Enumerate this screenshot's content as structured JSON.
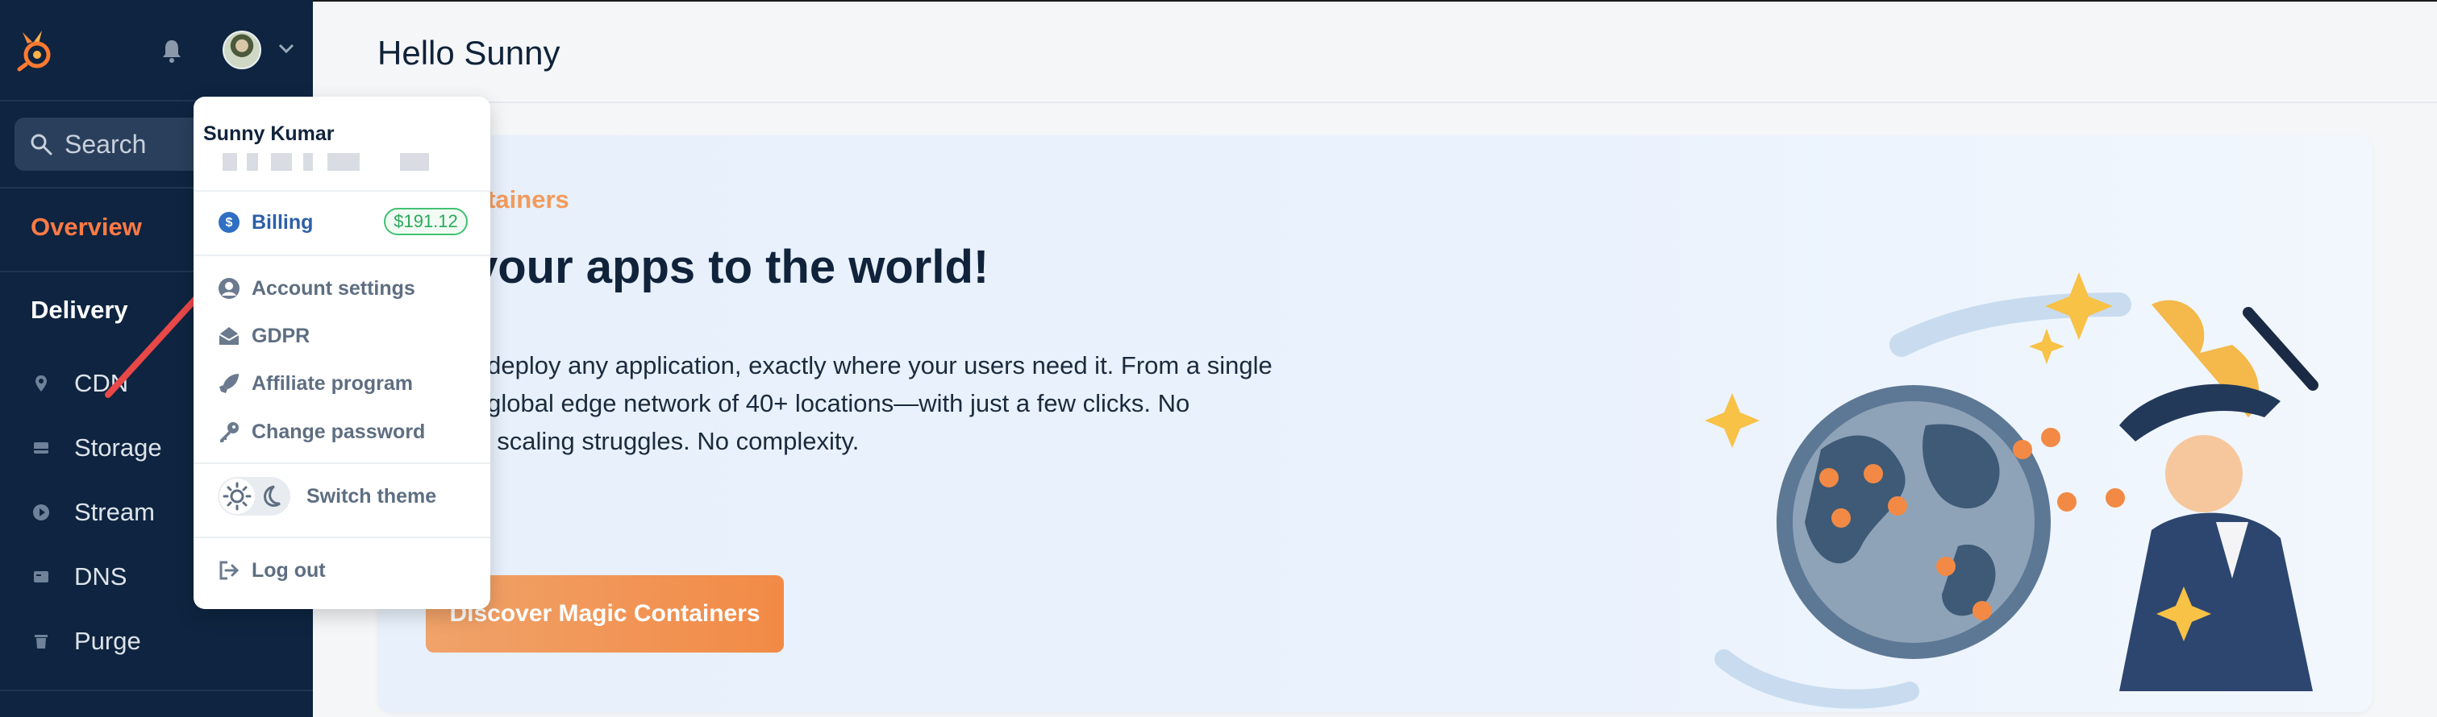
{
  "colors": {
    "sidebar_bg": "#0e2440",
    "accent_orange": "#ff7a45",
    "billing_blue": "#2c5fa8",
    "badge_green": "#41c172",
    "annotation_red": "#e84848"
  },
  "sidebar": {
    "search_label": "Search",
    "overview_label": "Overview",
    "section_title": "Delivery",
    "items": [
      {
        "label": "CDN",
        "icon": "map-pin-icon"
      },
      {
        "label": "Storage",
        "icon": "storage-icon"
      },
      {
        "label": "Stream",
        "icon": "play-icon"
      },
      {
        "label": "DNS",
        "icon": "dns-icon"
      },
      {
        "label": "Purge",
        "icon": "trash-icon"
      }
    ]
  },
  "header": {
    "title": "Hello Sunny"
  },
  "hero": {
    "kicker": "c Containers",
    "title": "ng your apps to the world!",
    "desc_lines": [
      "lessly deploy any application, exactly where your users need it. From a single",
      "n to a global edge network of 40+ locations—with just a few clicks. No",
      "ps. No scaling struggles. No complexity."
    ],
    "cta": "Discover Magic Containers"
  },
  "user_menu": {
    "name": "Sunny Kumar",
    "items": [
      {
        "label": "Billing",
        "icon": "dollar-icon",
        "badge": "$191.12"
      },
      {
        "label": "Account settings",
        "icon": "user-circle-icon"
      },
      {
        "label": "GDPR",
        "icon": "envelope-open-icon"
      },
      {
        "label": "Affiliate program",
        "icon": "rocket-icon"
      },
      {
        "label": "Change password",
        "icon": "key-icon"
      }
    ],
    "theme_label": "Switch theme",
    "logout_label": "Log out"
  }
}
